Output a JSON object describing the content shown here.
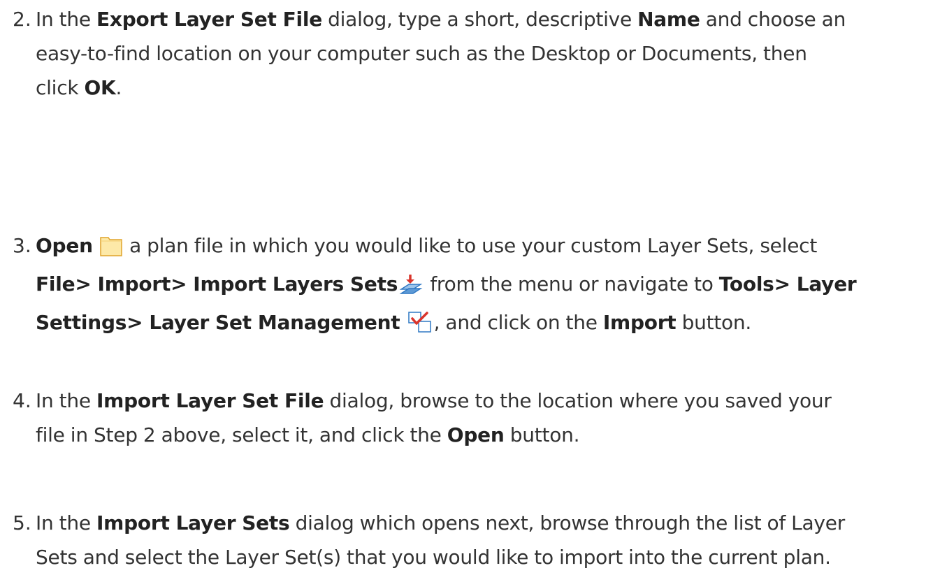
{
  "steps": [
    {
      "number": "2.",
      "line1": {
        "t1": "In the ",
        "b1": "Export Layer Set File",
        "t2": " dialog, type a short, descriptive ",
        "b2": "Name",
        "t3": " and choose an"
      },
      "line2": "easy-to-find location on your computer such as the Desktop or Documents, then",
      "line3": {
        "t1": "click ",
        "b1": "OK",
        "t2": "."
      }
    },
    {
      "number": "3.",
      "line1": {
        "b1": "Open",
        "icon1": "folder-icon",
        "t1": " a plan file in which you would like to use your custom Layer Sets, select"
      },
      "line2": {
        "b1": "File> Import> Import Layers Sets",
        "icon2": "import-layer-sets-icon",
        "t1": " from the menu or navigate to ",
        "b2": "Tools> Layer"
      },
      "line3": {
        "b1": "Settings> Layer Set Management",
        "icon3": "layer-set-management-icon",
        "t1": ", and click on the ",
        "b2": "Import",
        "t2": " button."
      }
    },
    {
      "number": "4.",
      "line1": {
        "t1": "In the ",
        "b1": "Import Layer Set File",
        "t2": " dialog, browse to the location where you saved your"
      },
      "line2": {
        "t1": "file in Step 2 above, select it, and click the ",
        "b1": "Open",
        "t2": " button."
      }
    },
    {
      "number": "5.",
      "line1": {
        "t1": "In the ",
        "b1": "Import Layer Sets",
        "t2": " dialog which opens next, browse through the list of Layer"
      },
      "line2": "Sets and select the Layer Set(s) that you would like to import into the current plan."
    }
  ],
  "colors": {
    "text": "#333333",
    "folder_fill": "#fde9a8",
    "folder_stroke": "#e0a42b",
    "import_arrow": "#d9342b",
    "layer_blue": "#2f78c4",
    "check_red": "#d9342b"
  }
}
